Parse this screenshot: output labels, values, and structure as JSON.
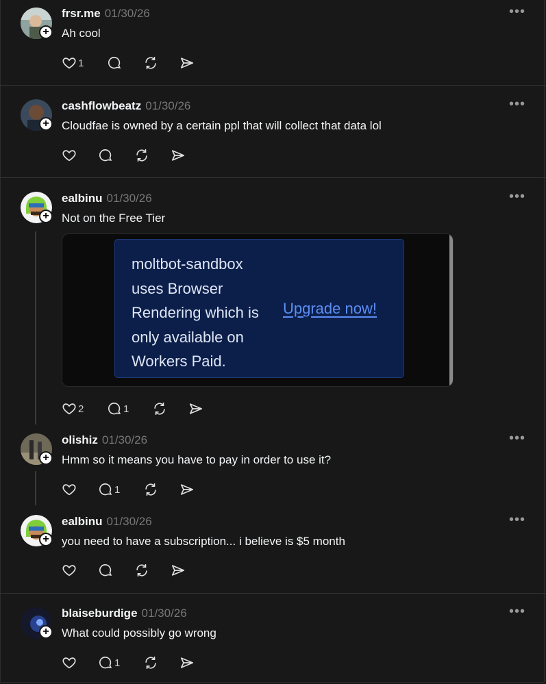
{
  "posts": [
    {
      "username": "frsr.me",
      "date": "01/30/26",
      "text": "Ah cool",
      "likes": "1",
      "replies": ""
    },
    {
      "username": "cashflowbeatz",
      "date": "01/30/26",
      "text": "Cloudfae is owned by a certain ppl that will collect that data lol",
      "likes": "",
      "replies": ""
    },
    {
      "username": "ealbinu",
      "date": "01/30/26",
      "text": "Not on the Free Tier",
      "likes": "2",
      "replies": "1",
      "media": {
        "message": "moltbot-sandbox uses Browser Rendering which is only available on Workers Paid.",
        "lines": [
          "moltbot-sandbox",
          "uses Browser",
          "Rendering which is",
          "only available on",
          "Workers Paid."
        ],
        "link": "Upgrade now!"
      }
    },
    {
      "username": "olishiz",
      "date": "01/30/26",
      "text": "Hmm so it means you have to pay in order to use it?",
      "likes": "",
      "replies": "1"
    },
    {
      "username": "ealbinu",
      "date": "01/30/26",
      "text": "you need to have a subscription... i believe is $5 month",
      "likes": "",
      "replies": ""
    },
    {
      "username": "blaiseburdige",
      "date": "01/30/26",
      "text": "What could possibly go wrong",
      "likes": "",
      "replies": "1"
    }
  ],
  "icons": {
    "follow": "+",
    "more": "•••"
  },
  "colors": {
    "background": "#181818",
    "text": "#f3f5f7",
    "muted": "#777777",
    "link": "#5b8ef5",
    "card": "#0c1f4a"
  }
}
